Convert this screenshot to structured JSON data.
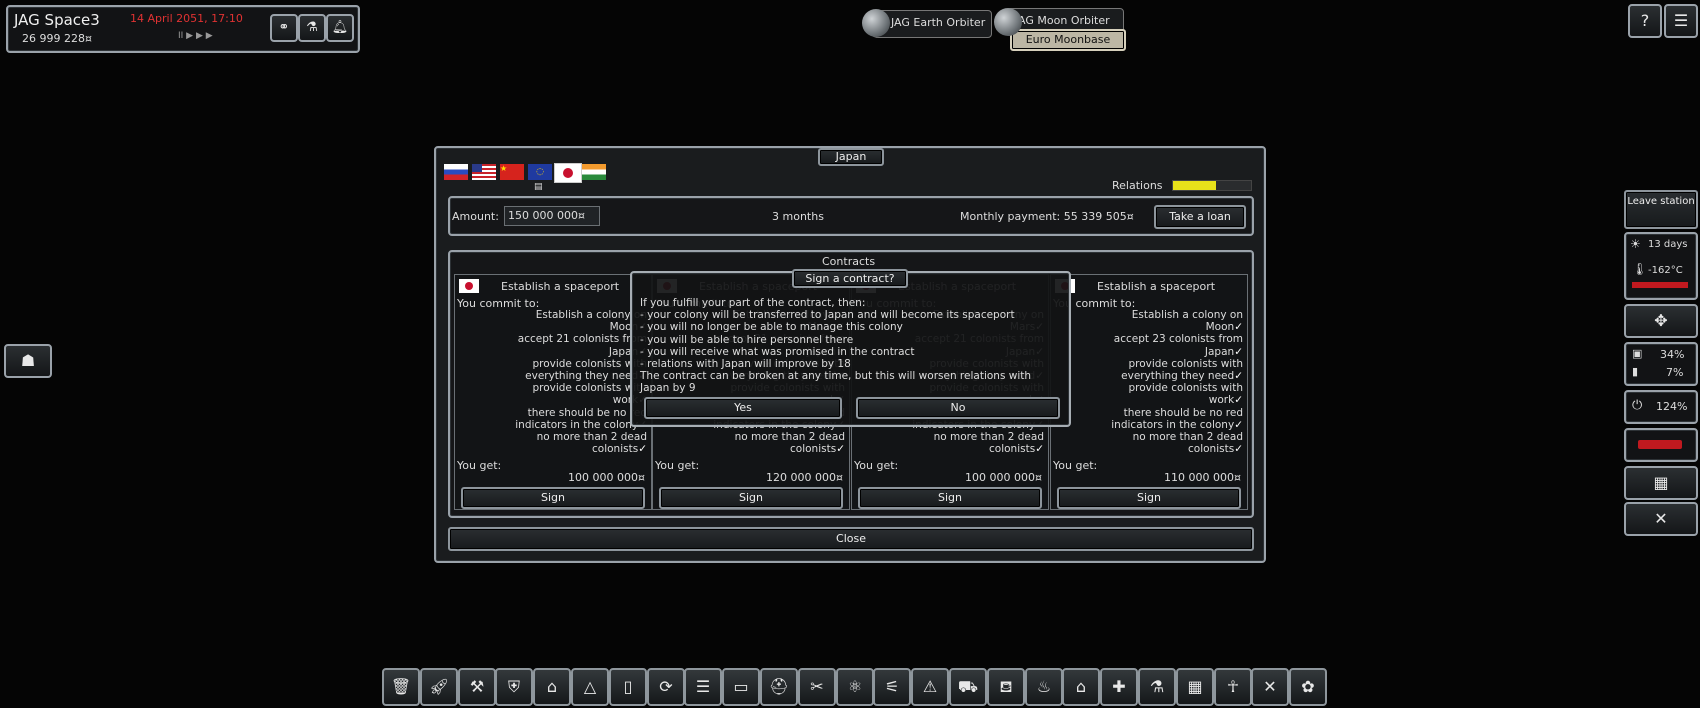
{
  "hud": {
    "station_name": "JAG Space3",
    "date": "14 April 2051, 17:10",
    "money": "26 999 228¤",
    "speed": "II ▶ ▶ ▶",
    "buttons": [
      "handshake-icon",
      "flask-icon",
      "bell-icon"
    ]
  },
  "orbiters": {
    "earth": "JAG Earth Orbiter",
    "moon": "JAG Moon Orbiter",
    "moonbase": "Euro Moonbase"
  },
  "window": {
    "title": "Japan",
    "relations_label": "Relations",
    "relations_value": 0.55,
    "flags": [
      "Russia",
      "USA",
      "China",
      "EU",
      "Japan",
      "India"
    ],
    "loan": {
      "amount_label": "Amount:",
      "amount_value": "150 000 000¤",
      "duration": "3 months",
      "monthly_label": "Monthly payment: 55 339 505¤",
      "take_loan": "Take a loan"
    },
    "contracts_title": "Contracts",
    "close": "Close",
    "contracts": [
      {
        "title": "Establish a spaceport",
        "commit": "You commit to:",
        "lines": [
          "Establish a colony on",
          "Moon",
          "accept 21 colonists from",
          "Japan",
          "provide colonists with",
          "everything they need",
          "provide colonists with",
          "work",
          "there should be no red",
          "indicators in the colony",
          "no more than 2 dead",
          "colonists"
        ],
        "get_label": "You get:",
        "get_value": "100 000 000¤",
        "sign": "Sign"
      },
      {
        "title": "Establish a spaceport",
        "commit": "You commit to:",
        "lines": [
          "Establish a colony on",
          "Moon",
          "accept 21 colonists from",
          "Japan",
          "provide colonists with",
          "everything they need",
          "provide colonists with",
          "work",
          "there should be no red",
          "indicators in the colony",
          "no more than 2 dead",
          "colonists"
        ],
        "get_label": "You get:",
        "get_value": "120 000 000¤",
        "sign": "Sign"
      },
      {
        "title": "Establish a spaceport",
        "commit": "You commit to:",
        "lines": [
          "Establish a colony on",
          "Mars",
          "accept 21 colonists from",
          "Japan",
          "provide colonists with",
          "everything they need",
          "provide colonists with",
          "work",
          "there should be no red",
          "indicators in the colony",
          "no more than 2 dead",
          "colonists"
        ],
        "get_label": "You get:",
        "get_value": "100 000 000¤",
        "sign": "Sign"
      },
      {
        "title": "Establish a spaceport",
        "commit": "You commit to:",
        "lines": [
          "Establish a colony on",
          "Moon",
          "accept 23 colonists from",
          "Japan",
          "provide colonists with",
          "everything they need",
          "provide colonists with",
          "work",
          "there should be no red",
          "indicators in the colony",
          "no more than 2 dead",
          "colonists"
        ],
        "get_label": "You get:",
        "get_value": "110 000 000¤",
        "sign": "Sign"
      }
    ]
  },
  "dialog": {
    "title": "Sign a contract?",
    "lines": [
      "If you fulfill your part of the contract, then:",
      "- your colony will be transferred to Japan and will become its spaceport",
      "- you will no longer be able to manage this colony",
      "- you will be able to hire personnel there",
      "- you will receive what was promised in the contract",
      "- relations with Japan will improve by 18",
      "The contract can be broken at any time, but this will worsen relations with",
      "Japan by 9"
    ],
    "yes": "Yes",
    "no": "No"
  },
  "right_panel": {
    "leave_station": "Leave station",
    "days": "13 days",
    "temperature": "-162°C",
    "temp_bar": "",
    "stat1": "34%",
    "stat2": "7%",
    "power": "124%"
  },
  "colors": {
    "accent_red": "#e2232a",
    "relations_bar": "#e8e21a",
    "date_red": "#e03232"
  },
  "toolbar_icons": [
    "trash-icon",
    "rocket-icon",
    "crane-icon",
    "shield-icon",
    "house-icon",
    "tent-icon",
    "door-icon",
    "cycle-icon",
    "signpost-icon",
    "container-icon",
    "helmet-icon",
    "tools-icon",
    "atom-icon",
    "telescope-icon",
    "warning-icon",
    "vehicle-icon",
    "bed-icon",
    "toilet-icon",
    "building-icon",
    "medical-icon",
    "lab-icon",
    "computer-icon",
    "meditation-icon",
    "cutlery-icon",
    "sprout-icon"
  ]
}
